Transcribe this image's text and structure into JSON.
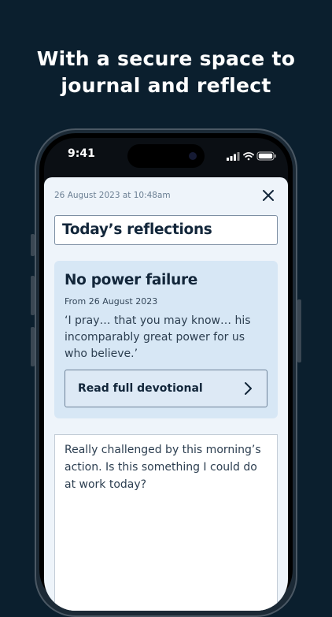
{
  "promo": {
    "headline": "With a secure space to journal and reflect"
  },
  "status_bar": {
    "time": "9:41",
    "icons": [
      "signal-icon",
      "wifi-icon",
      "battery-icon"
    ]
  },
  "journal": {
    "timestamp": "26 August 2023 at 10:48am",
    "title_value": "Today’s reflections",
    "devotional": {
      "title": "No power failure",
      "from": "From 26 August 2023",
      "quote": "‘I pray… that you may know… his incomparably great power for us who believe.’",
      "button_label": "Read full devotional"
    },
    "entry_text": "Really challenged by this morning’s action. Is this something I could do at work today?"
  },
  "colors": {
    "background": "#0b1f2e",
    "sheet": "#eef4fa",
    "card": "#d7e7f5",
    "text": "#12263a"
  }
}
